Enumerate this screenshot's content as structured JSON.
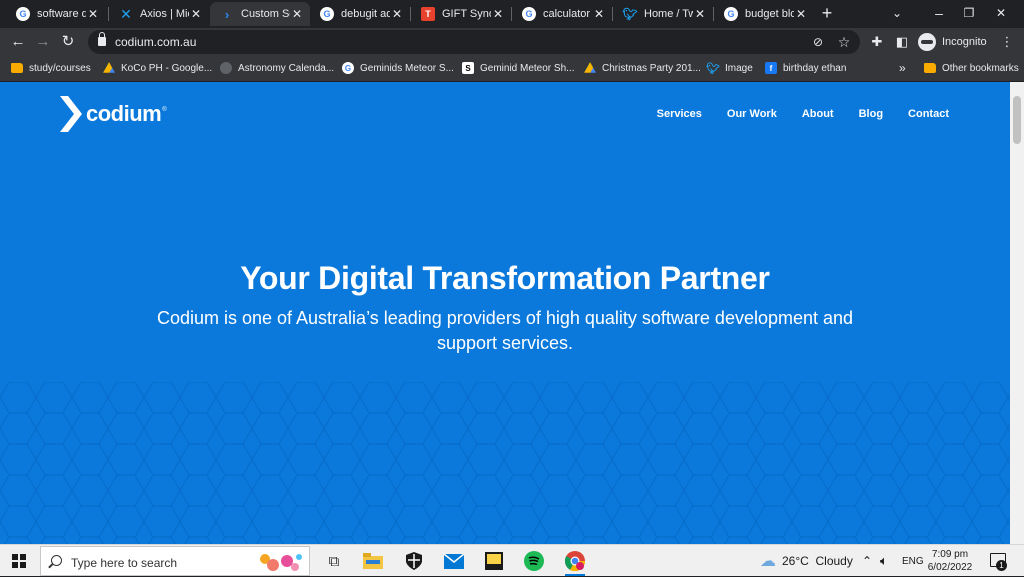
{
  "browser": {
    "tabs": [
      {
        "title": "software de",
        "icon": "google-icon",
        "color": "#ffffff"
      },
      {
        "title": "Axios | Mic",
        "icon": "axios-x-icon",
        "color": "#1da1f2"
      },
      {
        "title": "Custom Sof",
        "icon": "codium-chevron-icon",
        "color": "#0a79db",
        "active": true
      },
      {
        "title": "debugit adv",
        "icon": "google-icon",
        "color": "#ffffff"
      },
      {
        "title": "GIFT Synon",
        "icon": "thesaurus-icon",
        "color": "#e8412c"
      },
      {
        "title": "calculator",
        "icon": "google-icon",
        "color": "#ffffff"
      },
      {
        "title": "Home / Twi",
        "icon": "twitter-icon",
        "color": "#1da1f2"
      },
      {
        "title": "budget blo",
        "icon": "google-icon",
        "color": "#ffffff"
      }
    ],
    "new_tab": "+",
    "window_controls": {
      "minimize": "⌄",
      "restore": "❐",
      "close": "✕"
    },
    "url": "codium.com.au",
    "profile_label": "Incognito",
    "bookmarks": [
      {
        "label": "study/courses",
        "icon": "folder-icon"
      },
      {
        "label": "KoCo PH - Google...",
        "icon": "google-drive-icon"
      },
      {
        "label": "Astronomy Calenda...",
        "icon": "globe-icon"
      },
      {
        "label": "Geminids Meteor S...",
        "icon": "google-icon"
      },
      {
        "label": "Geminid Meteor Sh...",
        "icon": "s-icon"
      },
      {
        "label": "Christmas Party 201...",
        "icon": "google-drive-icon"
      },
      {
        "label": "Image",
        "icon": "twitter-icon"
      },
      {
        "label": "birthday ethan",
        "icon": "facebook-icon"
      }
    ],
    "bookmarks_overflow": "»",
    "other_bookmarks": "Other bookmarks"
  },
  "site": {
    "logo_text": "codium",
    "logo_reg": "®",
    "nav": [
      "Services",
      "Our Work",
      "About",
      "Blog",
      "Contact"
    ],
    "hero_title": "Your Digital Transformation Partner",
    "hero_subtitle": "Codium is one of Australia’s leading providers of high quality software development and support services.",
    "brand_color": "#0a79db"
  },
  "taskbar": {
    "search_placeholder": "Type here to search",
    "apps": [
      "task-view-icon",
      "file-explorer-icon",
      "security-icon",
      "mail-icon",
      "sticky-notes-icon",
      "spotify-icon",
      "chrome-icon"
    ],
    "weather": "26°C  Cloudy",
    "language": "ENG",
    "time": "7:09 pm",
    "date": "6/02/2022",
    "notification_count": "1"
  }
}
